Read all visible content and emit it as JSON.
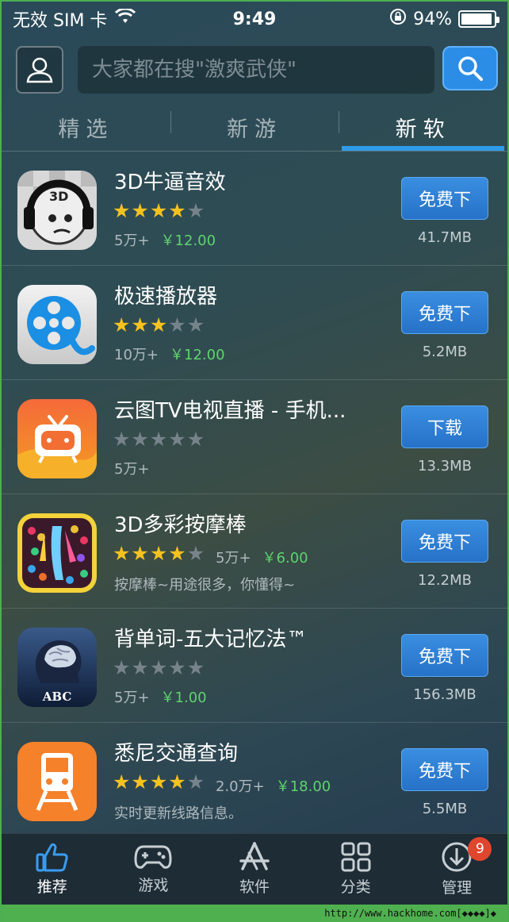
{
  "status_bar": {
    "carrier": "无效 SIM 卡",
    "time": "9:49",
    "battery_percent": "94%",
    "battery_level": 0.94
  },
  "search": {
    "placeholder": "大家都在搜\"激爽武侠\""
  },
  "tabs": [
    {
      "label": "精选",
      "active": false
    },
    {
      "label": "新游",
      "active": false
    },
    {
      "label": "新软",
      "active": true
    }
  ],
  "apps": [
    {
      "name": "3D牛逼音效",
      "rating": 4,
      "downloads": "5万+",
      "price": "￥12.00",
      "description": "",
      "button": "免费下",
      "size": "41.7MB",
      "icon": "headphones-face-icon"
    },
    {
      "name": "极速播放器",
      "rating": 3,
      "downloads": "10万+",
      "price": "￥12.00",
      "description": "",
      "button": "免费下",
      "size": "5.2MB",
      "icon": "film-reel-icon"
    },
    {
      "name": "云图TV电视直播 - 手机...",
      "rating": 0,
      "downloads": "5万+",
      "price": "",
      "description": "",
      "button": "下载",
      "size": "13.3MB",
      "icon": "tv-icon"
    },
    {
      "name": "3D多彩按摩棒",
      "rating": 4,
      "downloads": "5万+",
      "price": "￥6.00",
      "description": "按摩棒~用途很多，你懂得~",
      "button": "免费下",
      "size": "12.2MB",
      "icon": "colorful-lights-icon"
    },
    {
      "name": "背单词-五大记忆法™",
      "rating": 0,
      "downloads": "5万+",
      "price": "￥1.00",
      "description": "",
      "button": "免费下",
      "size": "156.3MB",
      "icon": "brain-abc-icon"
    },
    {
      "name": "悉尼交通查询",
      "rating": 4,
      "downloads": "2.0万+",
      "price": "￥18.00",
      "description": "实时更新线路信息。",
      "button": "免费下",
      "size": "5.5MB",
      "icon": "train-icon"
    }
  ],
  "bottom_nav": [
    {
      "label": "推荐",
      "icon": "thumbs-up-icon",
      "active": true
    },
    {
      "label": "游戏",
      "icon": "gamepad-icon",
      "active": false
    },
    {
      "label": "软件",
      "icon": "app-store-icon",
      "active": false
    },
    {
      "label": "分类",
      "icon": "grid-icon",
      "active": false
    },
    {
      "label": "管理",
      "icon": "download-icon",
      "active": false,
      "badge": "9"
    }
  ],
  "footer": {
    "url": "http://www.hackhome.com[◆◆◆◆]◆"
  },
  "colors": {
    "accent": "#2f9be8",
    "price": "#5fd36e",
    "star": "#f6c21f",
    "badge": "#e0452d"
  }
}
